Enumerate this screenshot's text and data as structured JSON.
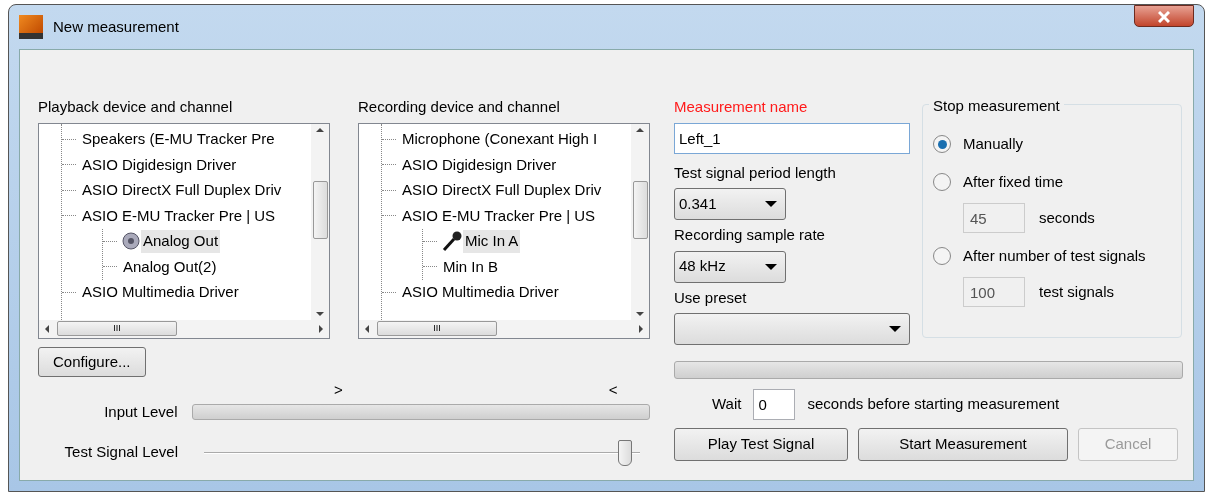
{
  "window": {
    "title": "New measurement"
  },
  "playback": {
    "label": "Playback device and channel",
    "items": [
      {
        "label": "Speakers (E-MU Tracker Pre",
        "selected": false
      },
      {
        "label": "ASIO Digidesign Driver",
        "selected": false
      },
      {
        "label": "ASIO DirectX Full Duplex Driv",
        "selected": false
      },
      {
        "label": "ASIO E-MU Tracker Pre | US",
        "selected": false,
        "children": [
          {
            "label": "Analog Out",
            "selected": true,
            "kind": "speaker"
          },
          {
            "label": "Analog Out(2)",
            "selected": false
          }
        ]
      },
      {
        "label": "ASIO Multimedia Driver",
        "selected": false
      }
    ],
    "h_scroll_label": "III"
  },
  "recording": {
    "label": "Recording device and channel",
    "items": [
      {
        "label": "Microphone (Conexant High I",
        "selected": false
      },
      {
        "label": "ASIO Digidesign Driver",
        "selected": false
      },
      {
        "label": "ASIO DirectX Full Duplex Driv",
        "selected": false
      },
      {
        "label": "ASIO E-MU Tracker Pre | US",
        "selected": false,
        "children": [
          {
            "label": "Mic In A",
            "selected": true,
            "kind": "mic"
          },
          {
            "label": "Min In B",
            "selected": false
          }
        ]
      },
      {
        "label": "ASIO Multimedia Driver",
        "selected": false
      }
    ],
    "h_scroll_label": "III"
  },
  "configure_button": "Configure...",
  "level_markers": [
    ">",
    "<"
  ],
  "input_level": {
    "label": "Input Level",
    "level": 0
  },
  "test_signal_level": {
    "label": "Test Signal Level",
    "level": 0.98
  },
  "measurement_name": {
    "label": "Measurement name",
    "value": "Left_1"
  },
  "period_length": {
    "label": "Test signal period length",
    "value": "0.341"
  },
  "sample_rate": {
    "label": "Recording sample rate",
    "value": "48 kHz"
  },
  "preset": {
    "label": "Use preset"
  },
  "stop_measurement": {
    "title": "Stop measurement",
    "options": [
      {
        "label": "Manually",
        "selected": true
      },
      {
        "label": "After fixed time",
        "selected": false,
        "value": "45",
        "unit": "seconds"
      },
      {
        "label": "After number of test signals",
        "selected": false,
        "value": "100",
        "unit": "test signals"
      }
    ]
  },
  "progress": {
    "level": 0
  },
  "wait": {
    "label": "Wait",
    "value": "0",
    "suffix": "seconds before starting measurement"
  },
  "buttons": [
    {
      "label": "Play Test Signal",
      "disabled": false
    },
    {
      "label": "Start Measurement",
      "disabled": false
    },
    {
      "label": "Cancel",
      "disabled": true
    }
  ]
}
